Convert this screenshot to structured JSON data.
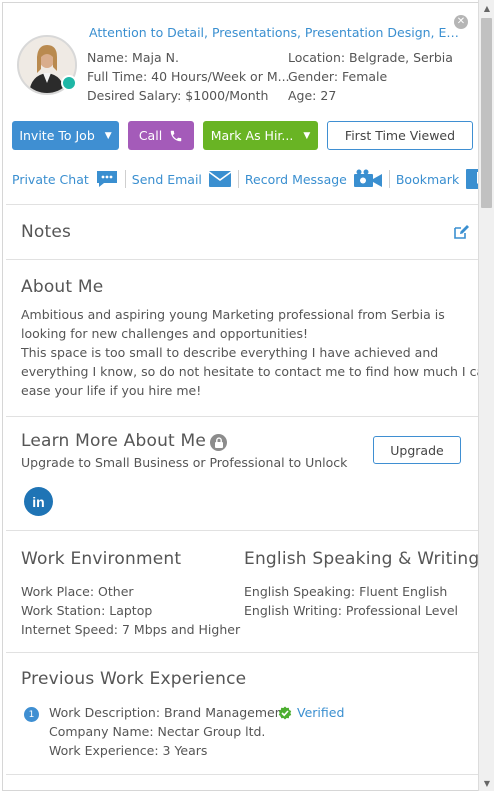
{
  "header": {
    "skills": "Attention to Detail, Presentations, Presentation Design, Event ...",
    "name_label": "Name: Maja N.",
    "location_label": "Location: Belgrade, Serbia",
    "fulltime_label": "Full Time: 40 Hours/Week or M...",
    "gender_label": "Gender: Female",
    "salary_label": "Desired Salary: $1000/Month",
    "age_label": "Age: 27",
    "online_color": "#1fb7a6"
  },
  "actions": {
    "invite_label": "Invite To Job",
    "call_label": "Call",
    "hire_label": "Mark As Hir...",
    "first_viewed_label": "First Time Viewed"
  },
  "links": {
    "private_chat": "Private Chat",
    "send_email": "Send Email",
    "record_message": "Record Message",
    "bookmark": "Bookmark"
  },
  "notes": {
    "title": "Notes"
  },
  "about": {
    "title": "About Me",
    "lines": [
      "Ambitious and aspiring young Marketing professional from Serbia is",
      "looking for new challenges and opportunities!",
      "This space is too small to describe everything I have achieved and",
      "everything I know, so do not hesitate to contact me to find how much I can",
      "ease your life if you hire me!"
    ]
  },
  "learn_more": {
    "title": "Learn More About Me",
    "subtitle": "Upgrade to Small Business or Professional to Unlock",
    "upgrade_label": "Upgrade",
    "linkedin_text": "in"
  },
  "work_env": {
    "title": "Work Environment",
    "place": "Work Place: Other",
    "station": "Work Station: Laptop",
    "internet": "Internet Speed: 7 Mbps and Higher"
  },
  "english": {
    "title": "English Speaking & Writing",
    "speaking": "English Speaking: Fluent English",
    "writing": "English Writing: Professional Level"
  },
  "experience": {
    "title": "Previous Work Experience",
    "items": [
      {
        "number": "1",
        "description": "Work Description: Brand Management",
        "verified": "Verified",
        "company": "Company Name:  Nectar Group ltd.",
        "years": "Work Experience:  3 Years"
      }
    ]
  },
  "colors": {
    "accent_blue": "#3f8fd2",
    "call_purple": "#a45bb9",
    "hire_green": "#69b424",
    "linkedin_blue": "#1f74b5"
  }
}
